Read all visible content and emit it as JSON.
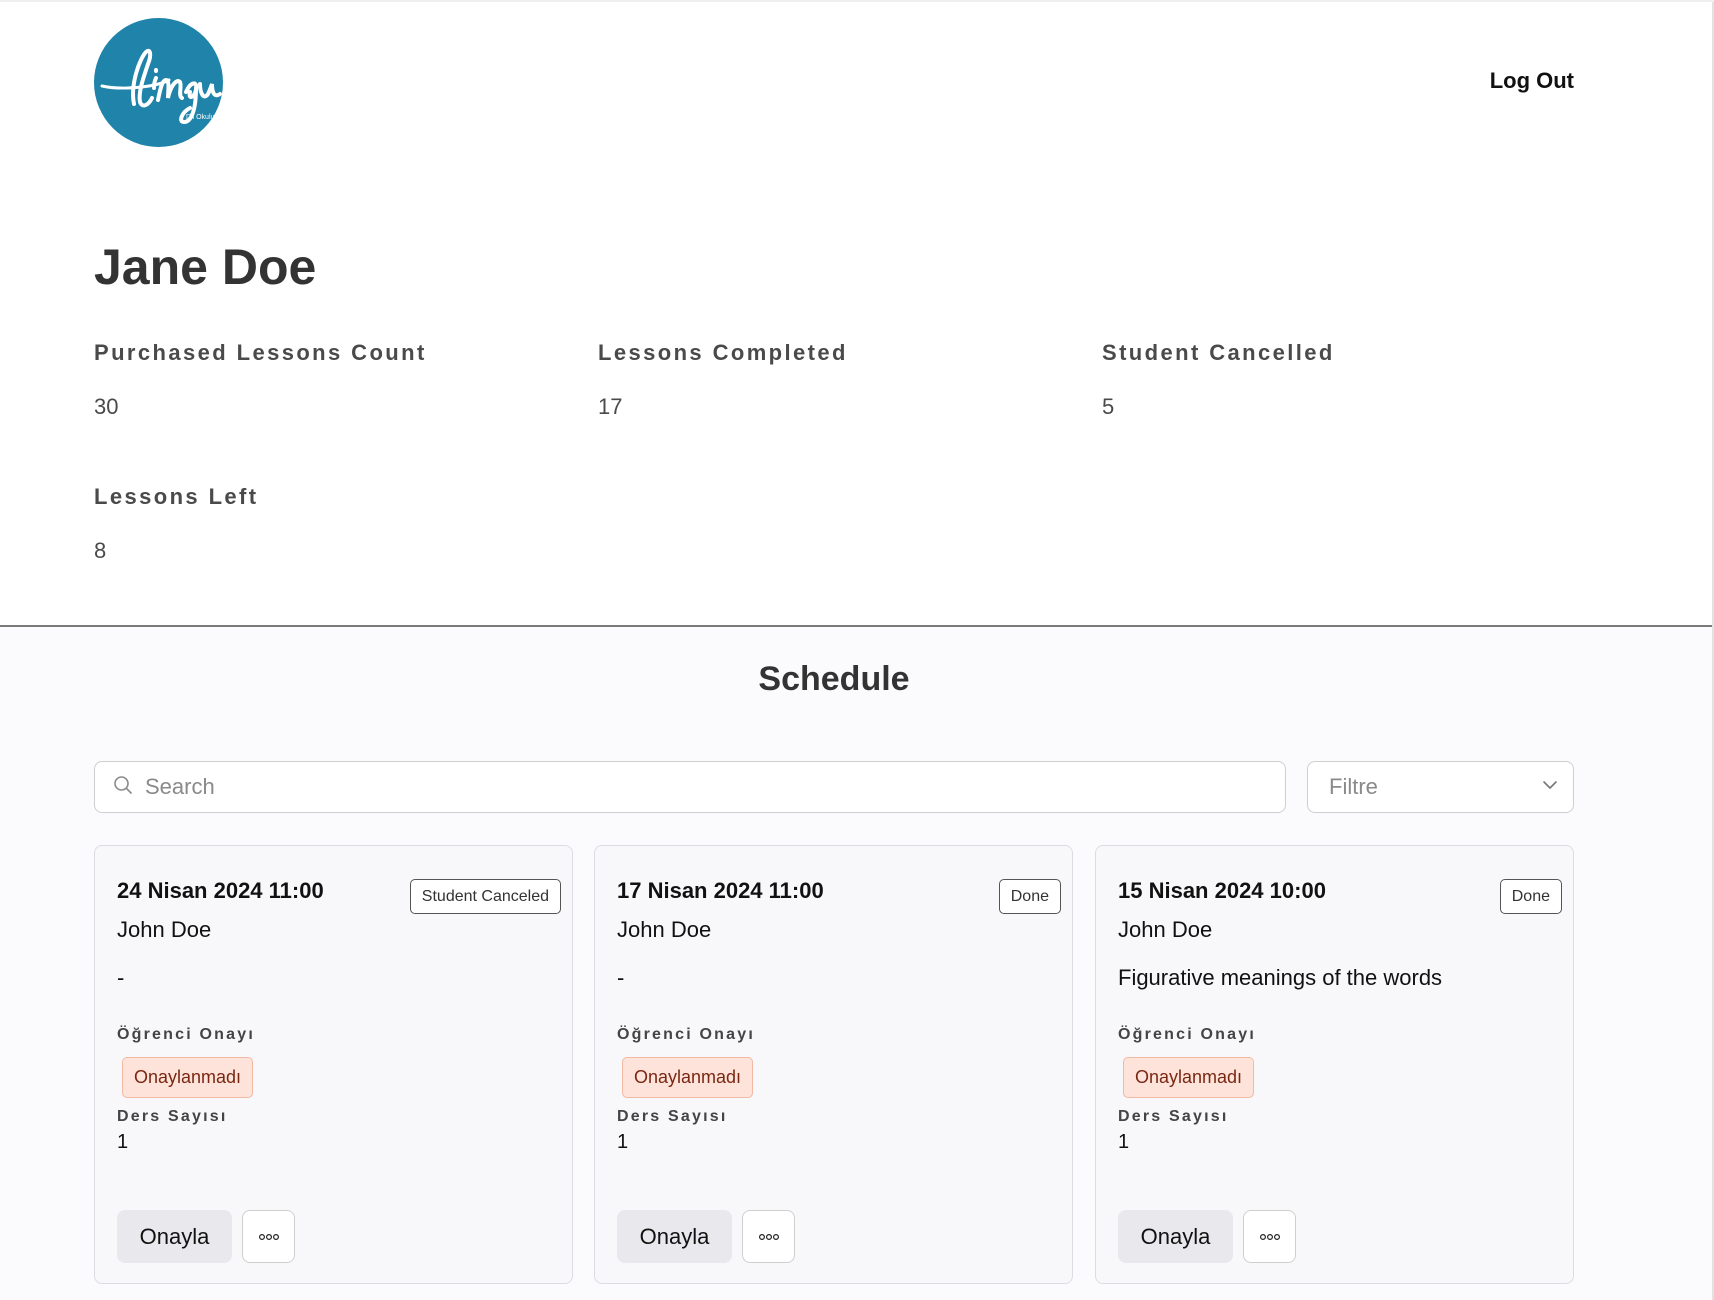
{
  "header": {
    "logo": {
      "icon": "lingu-logo",
      "brand_text": "lingu",
      "subtitle": "Dil Okulu",
      "color": "#1f83aa"
    },
    "logout_label": "Log Out"
  },
  "profile": {
    "name": "Jane Doe",
    "stats": [
      {
        "label": "Purchased Lessons Count",
        "value": "30"
      },
      {
        "label": "Lessons Completed",
        "value": "17"
      },
      {
        "label": "Student Cancelled",
        "value": "5"
      },
      {
        "label": "Lessons Left",
        "value": "8"
      }
    ]
  },
  "schedule": {
    "title": "Schedule",
    "search": {
      "placeholder": "Search",
      "icon": "search-icon"
    },
    "filter": {
      "placeholder": "Filtre",
      "icon": "chevron-down-icon"
    },
    "cards": [
      {
        "date": "24 Nisan 2024 11:00",
        "status": "Student Canceled",
        "teacher": "John Doe",
        "topic": "-",
        "approval_label": "Öğrenci Onayı",
        "approval_status": "Onaylanmadı",
        "count_label": "Ders Sayısı",
        "count": "1",
        "approve_label": "Onayla",
        "more_icon": "more-options-icon"
      },
      {
        "date": "17 Nisan 2024 11:00",
        "status": "Done",
        "teacher": "John Doe",
        "topic": "-",
        "approval_label": "Öğrenci Onayı",
        "approval_status": "Onaylanmadı",
        "count_label": "Ders Sayısı",
        "count": "1",
        "approve_label": "Onayla",
        "more_icon": "more-options-icon"
      },
      {
        "date": "15 Nisan 2024 10:00",
        "status": "Done",
        "teacher": "John Doe",
        "topic": "Figurative meanings of the words",
        "approval_label": "Öğrenci Onayı",
        "approval_status": "Onaylanmadı",
        "count_label": "Ders Sayısı",
        "count": "1",
        "approve_label": "Onayla",
        "more_icon": "more-options-icon"
      }
    ]
  },
  "colors": {
    "brand": "#1f83aa",
    "approval_bg": "#fde3da",
    "approval_text": "#7a2712",
    "card_bg": "#f8f8fb"
  }
}
